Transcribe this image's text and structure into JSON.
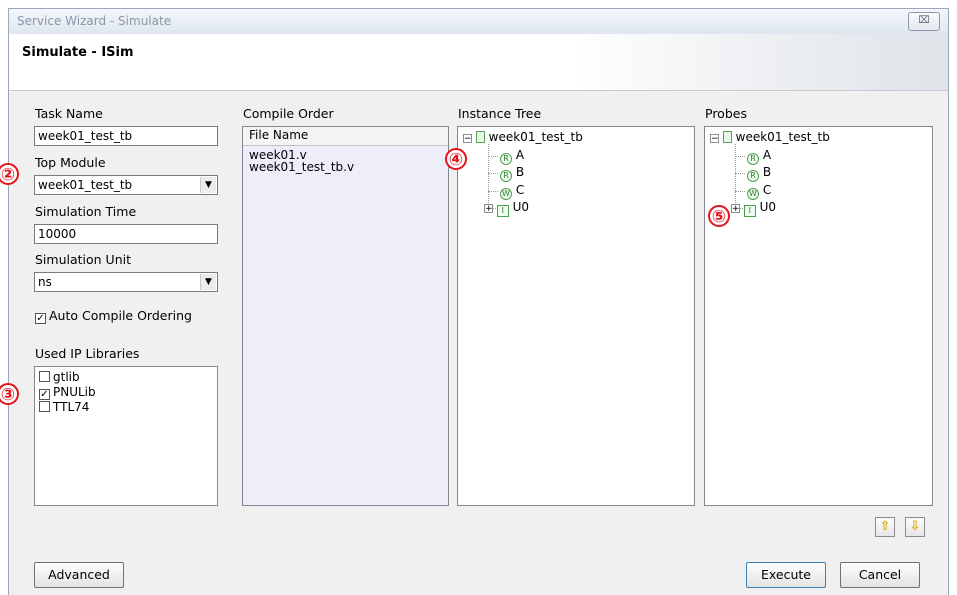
{
  "window": {
    "title": "Service Wizard - Simulate",
    "close_glyph": "⌧"
  },
  "banner": {
    "title": "Simulate - ISim"
  },
  "form": {
    "task_name_label": "Task Name",
    "task_name_value": "week01_test_tb",
    "top_module_label": "Top Module",
    "top_module_value": "week01_test_tb",
    "sim_time_label": "Simulation Time",
    "sim_time_value": "10000",
    "sim_unit_label": "Simulation Unit",
    "sim_unit_value": "ns",
    "auto_compile_label": "Auto Compile Ordering",
    "used_ip_label": "Used IP Libraries",
    "libraries": [
      {
        "name": "gtlib",
        "checked": false
      },
      {
        "name": "PNULib",
        "checked": true
      },
      {
        "name": "TTL74",
        "checked": false
      }
    ]
  },
  "compile_order": {
    "label": "Compile Order",
    "header": "File Name",
    "files": [
      "week01.v",
      "week01_test_tb.v"
    ]
  },
  "instance_tree": {
    "label": "Instance Tree",
    "root": "week01_test_tb",
    "children": [
      {
        "badge": "R",
        "name": "A"
      },
      {
        "badge": "R",
        "name": "B"
      },
      {
        "badge": "W",
        "name": "C"
      },
      {
        "badge": "I",
        "name": "U0"
      }
    ]
  },
  "probes": {
    "label": "Probes",
    "root": "week01_test_tb",
    "children": [
      {
        "badge": "R",
        "name": "A"
      },
      {
        "badge": "R",
        "name": "B"
      },
      {
        "badge": "W",
        "name": "C"
      },
      {
        "badge": "I",
        "name": "U0"
      }
    ]
  },
  "markers": [
    "②",
    "③",
    "④",
    "⑤"
  ],
  "buttons": {
    "advanced": "Advanced",
    "execute": "Execute",
    "cancel": "Cancel",
    "up_glyph": "⇧",
    "down_glyph": "⇩"
  },
  "colors": {
    "marker": "#e3141b",
    "compile_bg": "#eeeefa",
    "arrow": "#d9a400"
  }
}
